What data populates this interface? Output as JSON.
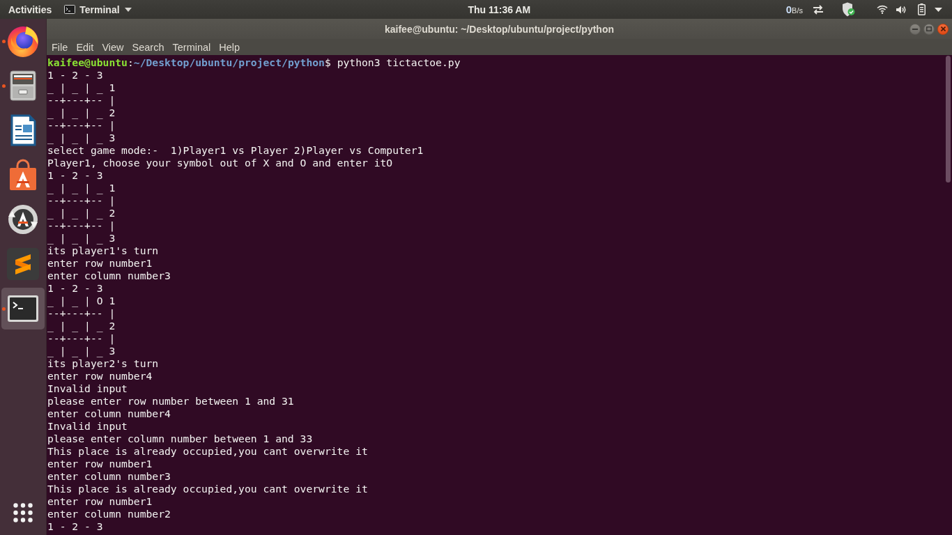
{
  "top_bar": {
    "activities": "Activities",
    "app_menu": "Terminal",
    "clock": "Thu 11:36 AM",
    "net_speed": {
      "value": "0",
      "unit": "B/s"
    }
  },
  "dock": {
    "items": [
      {
        "kind": "browser",
        "running": true,
        "selected": false
      },
      {
        "kind": "files",
        "running": true,
        "selected": false
      },
      {
        "kind": "writer",
        "running": false,
        "selected": false
      },
      {
        "kind": "software",
        "running": false,
        "selected": false
      },
      {
        "kind": "updater",
        "running": false,
        "selected": false
      },
      {
        "kind": "editor",
        "running": false,
        "selected": false
      },
      {
        "kind": "terminal",
        "running": true,
        "selected": true
      }
    ]
  },
  "window": {
    "title": "kaifee@ubuntu: ~/Desktop/ubuntu/project/python",
    "menu": [
      "File",
      "Edit",
      "View",
      "Search",
      "Terminal",
      "Help"
    ]
  },
  "terminal": {
    "prompt": {
      "user_host": "kaifee@ubuntu",
      "separator": ":",
      "path": "~/Desktop/ubuntu/project/python",
      "symbol": "$",
      "command": "python3 tictactoe.py"
    },
    "lines": [
      "1 - 2 - 3",
      "_ | _ | _ 1",
      "--+---+-- |",
      "_ | _ | _ 2",
      "--+---+-- |",
      "_ | _ | _ 3",
      "select game mode:-  1)Player1 vs Player 2)Player vs Computer1",
      "Player1, choose your symbol out of X and O and enter itO",
      "1 - 2 - 3",
      "_ | _ | _ 1",
      "--+---+-- |",
      "_ | _ | _ 2",
      "--+---+-- |",
      "_ | _ | _ 3",
      "its player1's turn",
      "enter row number1",
      "enter column number3",
      "1 - 2 - 3",
      "_ | _ | O 1",
      "--+---+-- |",
      "_ | _ | _ 2",
      "--+---+-- |",
      "_ | _ | _ 3",
      "its player2's turn",
      "enter row number4",
      "Invalid input",
      "please enter row number between 1 and 31",
      "enter column number4",
      "Invalid input",
      "please enter column number between 1 and 33",
      "This place is already occupied,you cant overwrite it",
      "enter row number1",
      "enter column number3",
      "This place is already occupied,you cant overwrite it",
      "enter row number1",
      "enter column number2",
      "1 - 2 - 3"
    ]
  }
}
